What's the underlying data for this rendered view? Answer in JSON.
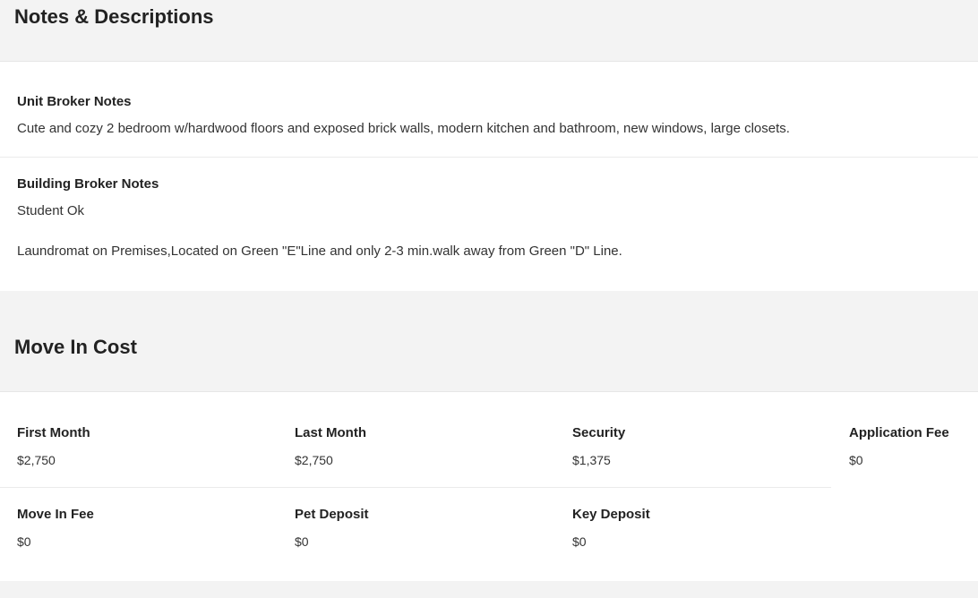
{
  "notes": {
    "title": "Notes & Descriptions",
    "unit": {
      "title": "Unit Broker Notes",
      "text": "Cute and cozy 2 bedroom w/hardwood floors and exposed brick walls, modern kitchen and bathroom, new windows, large closets."
    },
    "building": {
      "title": "Building Broker Notes",
      "line1": "Student Ok",
      "line2": "Laundromat on Premises,Located on Green \"E\"Line and only 2-3 min.walk away from Green \"D\" Line."
    }
  },
  "move_in": {
    "title": "Move In Cost",
    "items": [
      {
        "label": "First Month",
        "value": "$2,750"
      },
      {
        "label": "Last Month",
        "value": "$2,750"
      },
      {
        "label": "Security",
        "value": "$1,375"
      },
      {
        "label": "Application Fee",
        "value": "$0"
      },
      {
        "label": "Move In Fee",
        "value": "$0"
      },
      {
        "label": "Pet Deposit",
        "value": "$0"
      },
      {
        "label": "Key Deposit",
        "value": "$0"
      }
    ]
  }
}
